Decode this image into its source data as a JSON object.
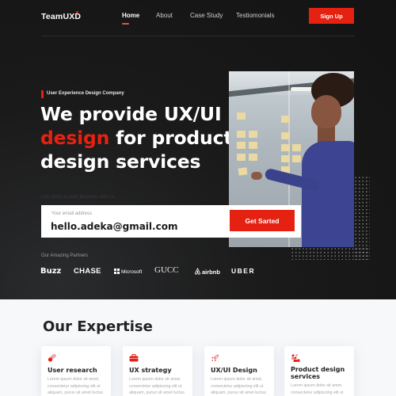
{
  "nav": {
    "logo": "TeamUXD",
    "links": [
      {
        "label": "Home",
        "active": true
      },
      {
        "label": "About",
        "active": false
      },
      {
        "label": "Case Study",
        "active": false
      },
      {
        "label": "Testiomonials",
        "active": false
      }
    ],
    "signup_label": "Sign Up"
  },
  "hero": {
    "eyebrow": "User Experience Design Company",
    "headline_part1": "We provide UX/UI",
    "headline_accent": "design",
    "headline_part2": "for product design services",
    "tagline": "Lets level up your business with us",
    "email_label": "Your email address",
    "email_value": "hello.adeka@gmail.com",
    "cta_label": "Get Sarted",
    "partners_label": "Our Amazing Partners",
    "partners": [
      "Buzz",
      "CHASE",
      "Microsoft",
      "GUCC",
      "airbnb",
      "UBER"
    ]
  },
  "expertise": {
    "title": "Our Expertise",
    "cards": [
      {
        "icon": "pill-icon",
        "title": "User research",
        "text": "Lorem ipsum dolor sit amet, consectetur adipiscing elit ut aliquam, purus sit amet luctus"
      },
      {
        "icon": "briefcase-icon",
        "title": "UX strategy",
        "text": "Lorem ipsum dolor sit amet, consectetur adipiscing elit ut aliquam, purus sit amet luctus"
      },
      {
        "icon": "rocket-icon",
        "title": "UX/UI Design",
        "text": "Lorem ipsum dolor sit amet, consectetur adipiscing elit ut aliquam, purus sit amet luctus"
      },
      {
        "icon": "team-icon",
        "title": "Product design services",
        "text": "Lorem ipsum dolor sit amet, consectetur adipiscing elit ut"
      }
    ]
  },
  "colors": {
    "accent": "#e52212",
    "hero_bg": "#131313",
    "page_bg": "#f7f8fa"
  }
}
